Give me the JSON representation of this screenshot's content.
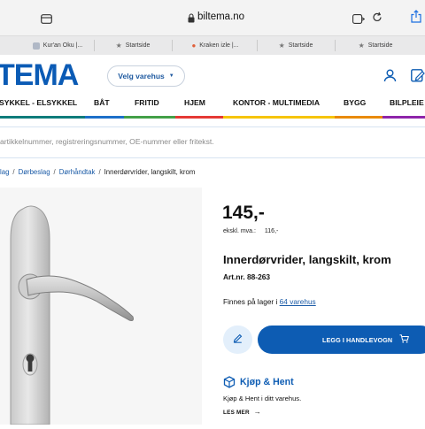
{
  "browser": {
    "url": "biltema.no",
    "tabs": [
      {
        "label": "Kur'an Oku |..."
      },
      {
        "label": "Startside"
      },
      {
        "label": "Kraken izle |..."
      },
      {
        "label": "Startside"
      },
      {
        "label": "Startside"
      }
    ]
  },
  "header": {
    "logo_text": "TEMA",
    "store_button_label": "Velg varehus",
    "brand_color": "#0b5bb5"
  },
  "categories": [
    {
      "label": "SYKKEL - ELSYKKEL",
      "color": "#0e7c7b"
    },
    {
      "label": "BÅT",
      "color": "#1d6fc9"
    },
    {
      "label": "FRITID",
      "color": "#43a047"
    },
    {
      "label": "HJEM",
      "color": "#e53935"
    },
    {
      "label": "KONTOR - MULTIMEDIA",
      "color": "#f6c400"
    },
    {
      "label": "BYGG",
      "color": "#e98a00"
    },
    {
      "label": "BILPLEIE",
      "color": "#8e24aa"
    }
  ],
  "search": {
    "placeholder": "artikkelnummer, registreringsnummer, OE-nummer eller fritekst."
  },
  "breadcrumb": {
    "items": [
      "lag",
      "Dørbeslag",
      "Dørhåndtak"
    ],
    "current": "Innerdørvrider, langskilt, krom"
  },
  "product": {
    "price": "145,-",
    "price_ex_label": "ekskl. mva.:",
    "price_ex_value": "116,-",
    "title": "Innerdørvrider, langskilt, krom",
    "art_nr": "Art.nr. 88-263",
    "stock_prefix": "Finnes på lager i",
    "stock_link": "64 varehus",
    "cart_button_label": "LEGG I HANDLEVOGN",
    "kjop_title": "Kjøp & Hent",
    "kjop_desc": "Kjøp & Hent i ditt varehus.",
    "les_mer": "LES MER"
  }
}
